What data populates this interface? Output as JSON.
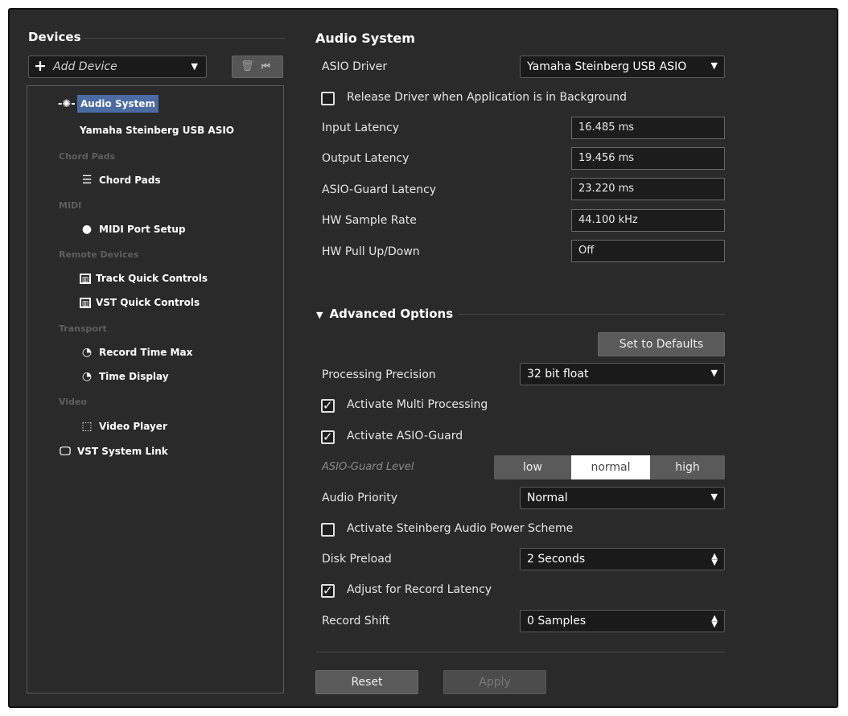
{
  "devices": {
    "title": "Devices",
    "add_device": "Add Device",
    "tree": {
      "audio_system": "Audio System",
      "yamaha": "Yamaha Steinberg USB ASIO",
      "group_chord_pads": "Chord Pads",
      "chord_pads": "Chord Pads",
      "group_midi": "MIDI",
      "midi_port_setup": "MIDI Port Setup",
      "group_remote": "Remote Devices",
      "track_quick_controls": "Track Quick Controls",
      "vst_quick_controls": "VST Quick Controls",
      "group_transport": "Transport",
      "record_time_max": "Record Time Max",
      "time_display": "Time Display",
      "group_video": "Video",
      "video_player": "Video Player",
      "vst_system_link": "VST System Link"
    }
  },
  "audio_system": {
    "title": "Audio System",
    "asio_driver_label": "ASIO Driver",
    "asio_driver_value": "Yamaha Steinberg USB ASIO",
    "release_driver_label": "Release Driver when Application is in Background",
    "release_driver_checked": false,
    "input_latency_label": "Input Latency",
    "input_latency_value": "16.485 ms",
    "output_latency_label": "Output Latency",
    "output_latency_value": "19.456 ms",
    "asio_guard_latency_label": "ASIO-Guard Latency",
    "asio_guard_latency_value": "23.220 ms",
    "hw_sample_rate_label": "HW Sample Rate",
    "hw_sample_rate_value": "44.100 kHz",
    "hw_pull_label": "HW Pull Up/Down",
    "hw_pull_value": "Off"
  },
  "advanced": {
    "title": "Advanced Options",
    "set_defaults": "Set to Defaults",
    "processing_precision_label": "Processing Precision",
    "processing_precision_value": "32 bit float",
    "multi_processing_label": "Activate Multi Processing",
    "multi_processing_checked": true,
    "asio_guard_label": "Activate ASIO-Guard",
    "asio_guard_checked": true,
    "asio_guard_level_label": "ASIO-Guard Level",
    "level_low": "low",
    "level_normal": "normal",
    "level_high": "high",
    "level_selected": "normal",
    "audio_priority_label": "Audio Priority",
    "audio_priority_value": "Normal",
    "power_scheme_label": "Activate Steinberg Audio Power Scheme",
    "power_scheme_checked": false,
    "disk_preload_label": "Disk Preload",
    "disk_preload_value": "2 Seconds",
    "adjust_record_label": "Adjust for Record Latency",
    "adjust_record_checked": true,
    "record_shift_label": "Record Shift",
    "record_shift_value": "0 Samples"
  },
  "footer": {
    "reset": "Reset",
    "apply": "Apply"
  },
  "colors": {
    "panel_bg": "#2a2a2a",
    "selection": "#4b6ba3",
    "segment_selected": "#ffffff",
    "segment_bg": "#5a5a5a"
  }
}
